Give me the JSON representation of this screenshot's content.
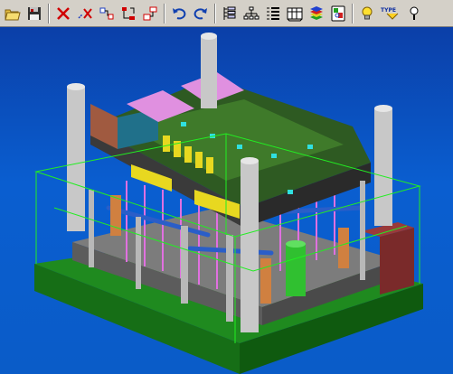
{
  "toolbar": {
    "buttons": [
      {
        "id": "open",
        "icon": "open-folder-icon"
      },
      {
        "id": "save",
        "icon": "save-disk-icon"
      },
      {
        "id": "delete",
        "icon": "delete-x-icon"
      },
      {
        "id": "delete-partial",
        "icon": "partial-delete-icon"
      },
      {
        "id": "connect",
        "icon": "connect-nodes-icon"
      },
      {
        "id": "move-tree",
        "icon": "move-tree-icon"
      },
      {
        "id": "copy-tree",
        "icon": "copy-tree-icon"
      },
      {
        "id": "undo",
        "icon": "undo-icon"
      },
      {
        "id": "redo",
        "icon": "redo-icon"
      },
      {
        "id": "list",
        "icon": "list-icon"
      },
      {
        "id": "hierarchy",
        "icon": "hierarchy-icon"
      },
      {
        "id": "numbered-list",
        "icon": "numbered-list-icon"
      },
      {
        "id": "bom",
        "icon": "bom-icon"
      },
      {
        "id": "layers",
        "icon": "layers-icon"
      },
      {
        "id": "properties",
        "icon": "properties-icon"
      },
      {
        "id": "hint",
        "icon": "lightbulb-icon"
      },
      {
        "id": "type",
        "icon": "type-icon",
        "label": "TYPE"
      },
      {
        "id": "help",
        "icon": "help-icon"
      }
    ]
  },
  "viewport": {
    "background_color": "#0a5cc0",
    "wireframe_color": "#22ee22"
  }
}
